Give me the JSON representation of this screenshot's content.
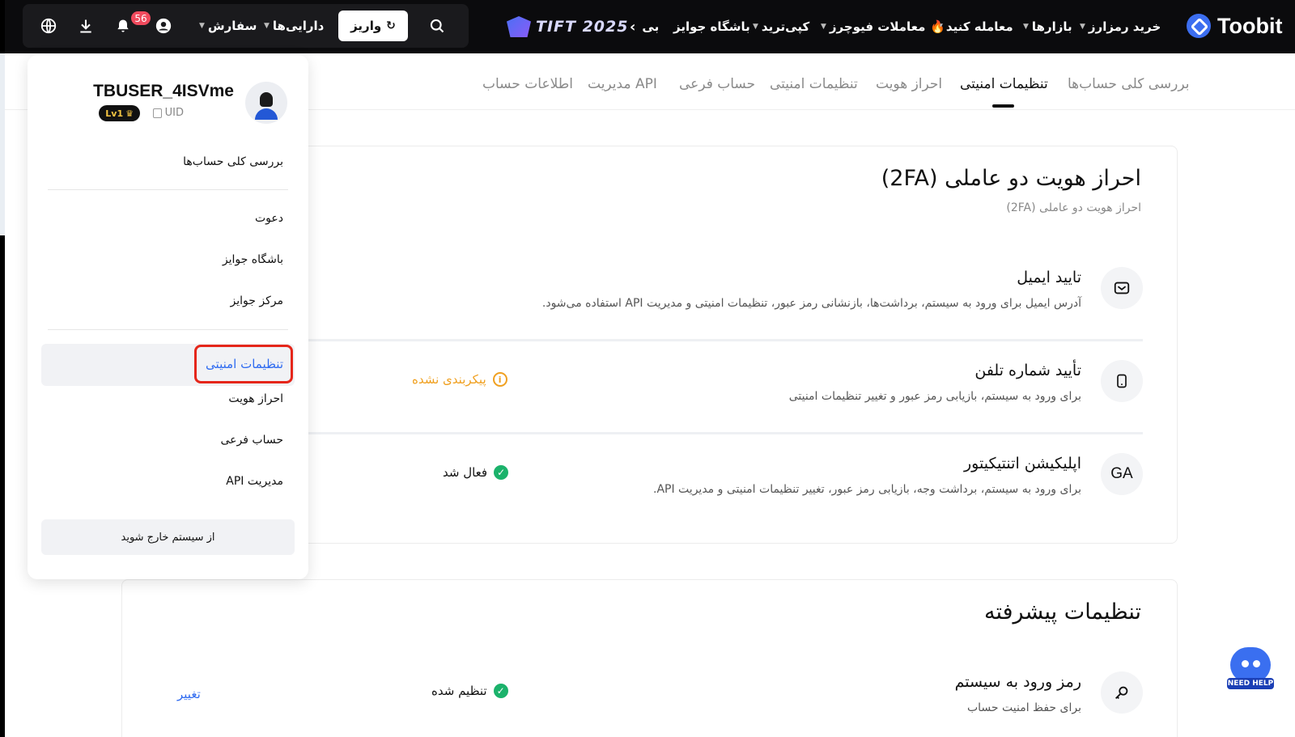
{
  "nav": {
    "brand": "Toobit",
    "items": [
      {
        "label": "خرید رمزارز",
        "caret": true
      },
      {
        "label": "بازارها",
        "caret": true
      },
      {
        "label": "معامله کنید",
        "caret": true
      },
      {
        "label": "معاملات فیوچرز",
        "caret": true,
        "emoji": "🔥"
      },
      {
        "label": "کپی‌ترید",
        "caret": true
      },
      {
        "label": "باشگاه جوایز",
        "caret": false
      },
      {
        "label": "بی",
        "caret": false
      }
    ],
    "promo": "TIFT 2025",
    "actions": {
      "deposit_label": "واریز",
      "assets_label": "دارایی‌ها",
      "orders_label": "سفارش",
      "notification_count": "56"
    }
  },
  "subtabs": [
    {
      "label": "بررسی کلی حساب‌ها"
    },
    {
      "label": "تنظیمات امنیتی",
      "active": true
    },
    {
      "label": "احراز هویت"
    },
    {
      "label": "تنظیمات امنیتی"
    },
    {
      "label": "حساب فرعی"
    },
    {
      "label": "مدیریت API"
    },
    {
      "label": "اطلاعات حساب"
    }
  ],
  "twofa": {
    "title": "احراز هویت دو عاملی (2FA)",
    "subtitle": "احراز هویت دو عاملی (2FA)",
    "rows": [
      {
        "icon": "envelope-icon",
        "title": "تایید ایمیل",
        "desc": "آدرس ایمیل برای ورود به سیستم، برداشت‌ها، بازنشانی رمز عبور، تنظیمات امنیتی و مدیریت API استفاده می‌شود.",
        "status": ""
      },
      {
        "icon": "phone-icon",
        "title": "تأیید شماره تلفن",
        "desc": "برای ورود به سیستم، بازیابی رمز عبور و تغییر تنظیمات امنیتی",
        "status": "پیکربندی نشده"
      },
      {
        "icon": "ga-icon",
        "icon_text": "GA",
        "title": "اپلیکیشن اتنتیکیتور",
        "desc": "برای ورود به سیستم، برداشت وجه، بازیابی رمز عبور، تغییر تنظیمات امنیتی و مدیریت API.",
        "status": "فعال شد"
      }
    ]
  },
  "advanced": {
    "title": "تنظیمات پیشرفته",
    "rows": [
      {
        "icon": "key-icon",
        "title": "رمز ورود به سیستم",
        "desc": "برای حفظ امنیت حساب",
        "status": "تنظیم شده",
        "action": "تغییر"
      }
    ]
  },
  "panel": {
    "username": "TBUSER_4ISVme",
    "uid_label": "UID",
    "level": "Lv1",
    "menu": [
      "بررسی کلی حساب‌ها",
      "دعوت",
      "باشگاه جوایز",
      "مرکز جوایز",
      "تنظیمات امنیتی",
      "احراز هویت",
      "حساب فرعی",
      "مدیریت API"
    ],
    "logout_label": "از سیستم خارج شوید"
  },
  "helpbot": {
    "label": "NEED HELP"
  }
}
